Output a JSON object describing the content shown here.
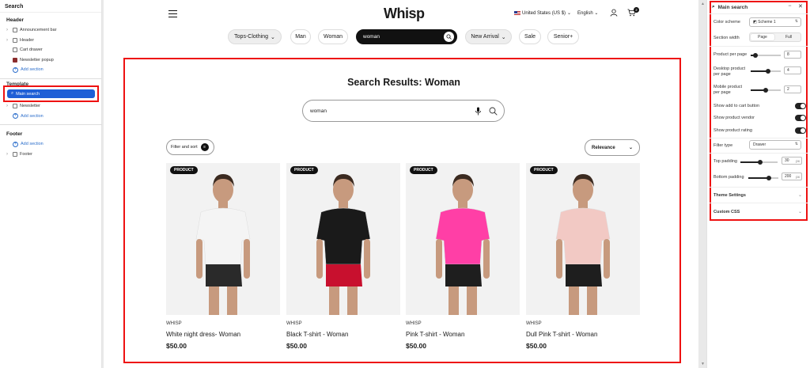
{
  "left": {
    "title": "Search",
    "header_group": "Header",
    "header_items": [
      "Announcement bar",
      "Header",
      "Cart drawer",
      "Newsletter popup"
    ],
    "add_section": "Add section",
    "template_group": "Template",
    "selected_item": "Main search",
    "template_items": [
      "Newsletter"
    ],
    "footer_group": "Footer",
    "footer_items": [
      "Footer"
    ]
  },
  "header": {
    "logo": "Whisp",
    "country": "United States (US $)",
    "language": "English",
    "cart_count": "2"
  },
  "nav": {
    "items": [
      "Tops-Clothing",
      "Man",
      "Woman",
      "woman",
      "New Arrival",
      "Sale",
      "Senior+"
    ]
  },
  "results": {
    "title": "Search Results: Woman",
    "query": "woman",
    "filter_label": "Filter and sort",
    "sort_label": "Relevance"
  },
  "products": [
    {
      "badge": "PRODUCT",
      "brand": "WHISP",
      "name": "White night dress- Woman",
      "price": "$50.00",
      "shirt": "#f4f4f4",
      "bottom": "#2a2a2a"
    },
    {
      "badge": "PRODUCT",
      "brand": "WHISP",
      "name": "Black T-shirt - Woman",
      "price": "$50.00",
      "shirt": "#1a1a1a",
      "bottom": "#c8102e"
    },
    {
      "badge": "PRODUCT",
      "brand": "WHISP",
      "name": "Pink T-shirt - Woman",
      "price": "$50.00",
      "shirt": "#ff3fa6",
      "bottom": "#1e1e1e"
    },
    {
      "badge": "PRODUCT",
      "brand": "WHISP",
      "name": "Dull Pink T-shirt - Woman",
      "price": "$50.00",
      "shirt": "#f2c9c4",
      "bottom": "#1e1e1e"
    }
  ],
  "panel": {
    "title": "Main search",
    "color_scheme_label": "Color scheme",
    "color_scheme_value": "Scheme 1",
    "section_width_label": "Section width",
    "section_width_options": [
      "Page",
      "Full"
    ],
    "section_width_selected": "Page",
    "product_per_page_label": "Product per page",
    "product_per_page": "8",
    "desktop_label": "Desktop product per page",
    "desktop_value": "4",
    "mobile_label": "Mobile product per page",
    "mobile_value": "2",
    "add_to_cart_label": "Show add to cart button",
    "vendor_label": "Show product vendor",
    "rating_label": "Show product rating",
    "filter_type_label": "Filter type",
    "filter_type_value": "Drawer",
    "top_padding_label": "Top padding",
    "top_padding": "30",
    "bottom_padding_label": "Bottom padding",
    "bottom_padding": "200",
    "unit": "px",
    "theme_settings": "Theme Settings",
    "custom_css": "Custom CSS"
  },
  "colors": {
    "accent": "#1f5fd6",
    "highlight": "#e11111"
  }
}
